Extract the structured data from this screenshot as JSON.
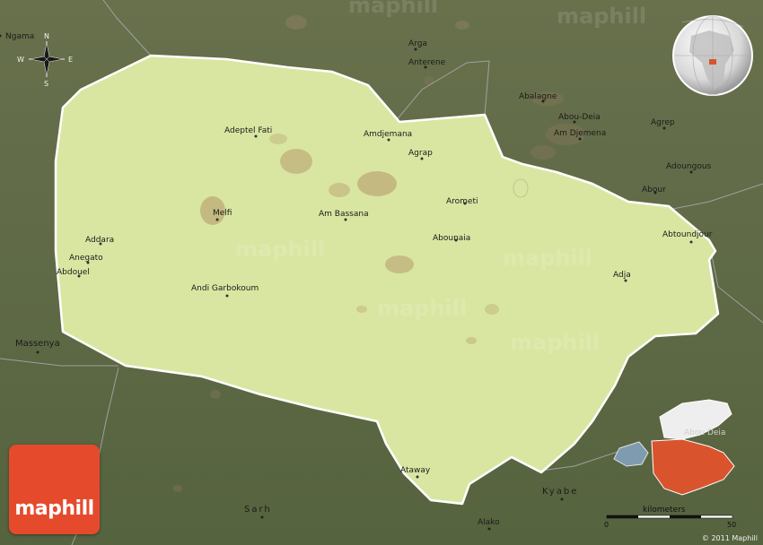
{
  "colors": {
    "background_terrain": "#5f6b47",
    "region_fill": "#d9e6a2",
    "region_border": "#ffffff",
    "relief_shade": "#a8825a",
    "logo_red": "#e64a2c",
    "inset_highlight": "#d9542d",
    "inset_neighbor": "#eeeeee",
    "lake_blue": "#7f9bb0"
  },
  "compass": {
    "north": "N",
    "south": "S",
    "east": "E",
    "west": "W"
  },
  "places": {
    "inside": [
      {
        "name": "Adeptel Fati"
      },
      {
        "name": "Amdjemana"
      },
      {
        "name": "Agrap"
      },
      {
        "name": "Melfi"
      },
      {
        "name": "Am Bassana"
      },
      {
        "name": "Arometi"
      },
      {
        "name": "Abounaia"
      },
      {
        "name": "Addara"
      },
      {
        "name": "Anegato"
      },
      {
        "name": "Abdouel"
      },
      {
        "name": "Andi Garbokoum"
      },
      {
        "name": "Abtoundjour"
      },
      {
        "name": "Adja"
      },
      {
        "name": "Ataway"
      }
    ],
    "outside": [
      {
        "name": "Ngama"
      },
      {
        "name": "Arga"
      },
      {
        "name": "Anterene"
      },
      {
        "name": "Abalagne"
      },
      {
        "name": "Abou-Deia"
      },
      {
        "name": "Am Djemena"
      },
      {
        "name": "Agrep"
      },
      {
        "name": "Adoungous"
      },
      {
        "name": "Abour"
      },
      {
        "name": "Massenya"
      },
      {
        "name": "Kyabe"
      },
      {
        "name": "Sarh"
      },
      {
        "name": "Alako"
      }
    ]
  },
  "inset": {
    "label": "Abou Deia"
  },
  "scale_bar": {
    "unit_label": "kilometers",
    "start": "0",
    "end": "50"
  },
  "logo": {
    "text": "maphill"
  },
  "copyright": "© 2011 Maphill",
  "watermark": "maphill"
}
